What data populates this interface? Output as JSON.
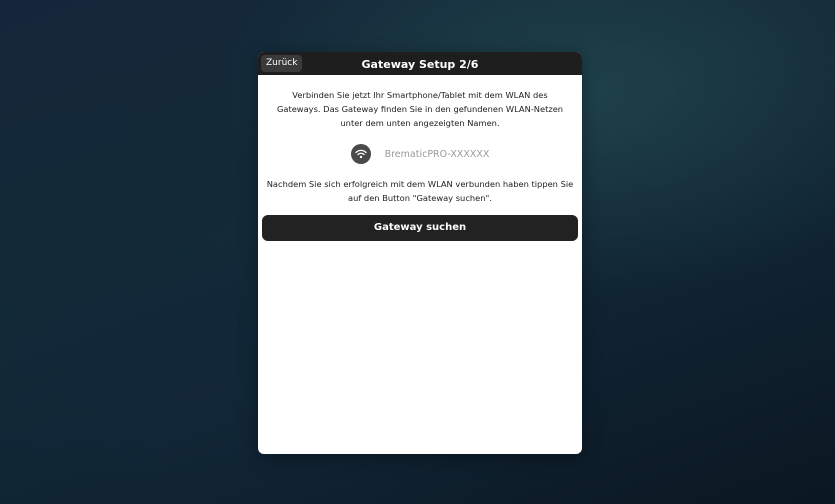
{
  "dialog": {
    "back_label": "Zurück",
    "title": "Gateway Setup 2/6",
    "intro_text": "Verbinden Sie jetzt Ihr Smartphone/Tablet mit dem WLAN des Gateways. Das Gateway finden Sie in den gefundenen WLAN-Netzen unter dem unten angezeigten Namen.",
    "network": {
      "icon": "wifi-icon",
      "ssid": "BrematicPRO-XXXXXX"
    },
    "after_text": "Nachdem Sie sich erfolgreich mit dem WLAN verbunden haben tippen Sie auf den Button \"Gateway suchen\".",
    "search_button_label": "Gateway suchen"
  },
  "colors": {
    "titlebar": "#1e1e1e",
    "button": "#222222",
    "card": "#ffffff",
    "ssid_text": "#9a9a9a",
    "background": "#132a36"
  }
}
